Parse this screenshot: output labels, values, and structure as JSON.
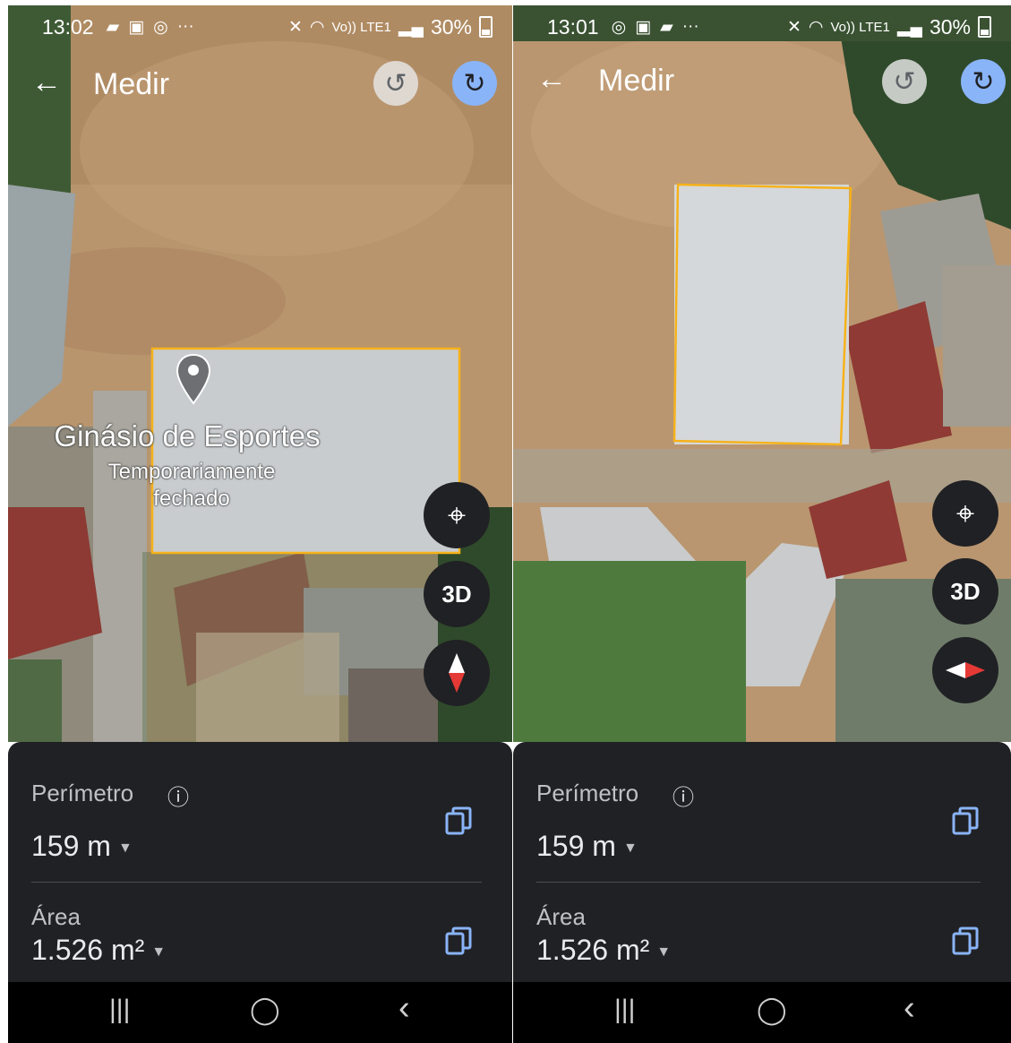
{
  "left": {
    "status": {
      "time": "13:02",
      "net": "Vo)) LTE1",
      "battery": "30%"
    },
    "header": {
      "back": "←",
      "title": "Medir",
      "undo": "↺",
      "redo": "↻"
    },
    "place": {
      "name": "Ginásio de Esportes",
      "status": "Temporariamente fechado"
    },
    "buttons": {
      "location": "⌖",
      "three_d": "3D"
    },
    "perimeter": {
      "label": "Perímetro",
      "help": "ⓘ",
      "value": "159 m",
      "caret": "▼"
    },
    "area": {
      "label": "Área",
      "value": "1.526 m²",
      "caret": "▼"
    },
    "nav": {
      "recents": "|||",
      "home": "◯",
      "back": "‹"
    }
  },
  "right": {
    "status": {
      "time": "13:01",
      "net": "Vo)) LTE1",
      "battery": "30%"
    },
    "header": {
      "back": "←",
      "title": "Medir",
      "undo": "↺",
      "redo": "↻"
    },
    "buttons": {
      "location": "⌖",
      "three_d": "3D"
    },
    "perimeter": {
      "label": "Perímetro",
      "help": "ⓘ",
      "value": "159 m",
      "caret": "▼"
    },
    "area": {
      "label": "Área",
      "value": "1.526 m²",
      "caret": "▼"
    },
    "nav": {
      "recents": "|||",
      "home": "◯",
      "back": "‹"
    }
  },
  "colors": {
    "measure_outline": "#f6b21a",
    "panel_bg": "#202124",
    "redo_accent": "#8ab4f8",
    "compass_red": "#e53935"
  },
  "icons": [
    "back-arrow-icon",
    "undo-icon",
    "redo-icon",
    "place-pin-icon",
    "my-location-icon",
    "compass-icon",
    "help-icon",
    "copy-icon",
    "wifi-icon",
    "signal-icon",
    "battery-icon",
    "mute-icon",
    "whatsapp-icon",
    "gallery-icon",
    "chat-icon"
  ]
}
